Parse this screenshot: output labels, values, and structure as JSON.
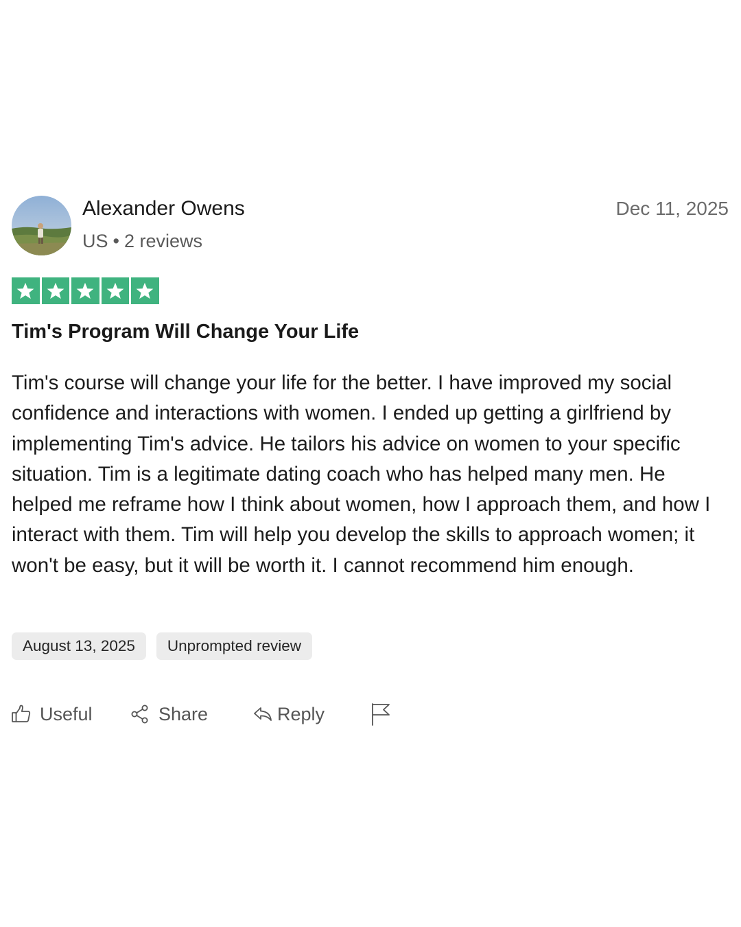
{
  "reviewer": {
    "name": "Alexander Owens",
    "country": "US",
    "separator": "•",
    "reviews_count": "2 reviews"
  },
  "review": {
    "date": "Dec 11, 2025",
    "rating": 5,
    "rating_max": 5,
    "star_color": "#3fb37f",
    "title": "Tim's Program Will Change Your Life",
    "body": "Tim's course will change your life for the better. I have improved my social confidence and interactions with women. I ended up getting a girlfriend by implementing Tim's advice. He tailors his advice on women to your specific situation. Tim is a legitimate dating coach who has helped many men. He helped me reframe how I think about women, how I approach them, and how I interact with them. Tim will help you develop the skills to approach women; it won't be easy, but it will be worth it. I cannot recommend him enough.",
    "experience_date": "August 13, 2025",
    "badge": "Unprompted review"
  },
  "actions": {
    "useful_label": "Useful",
    "useful_icon": "thumbs-up-icon",
    "share_label": "Share",
    "share_icon": "share-icon",
    "reply_label": "Reply",
    "reply_icon": "reply-icon",
    "report_icon": "flag-icon"
  }
}
